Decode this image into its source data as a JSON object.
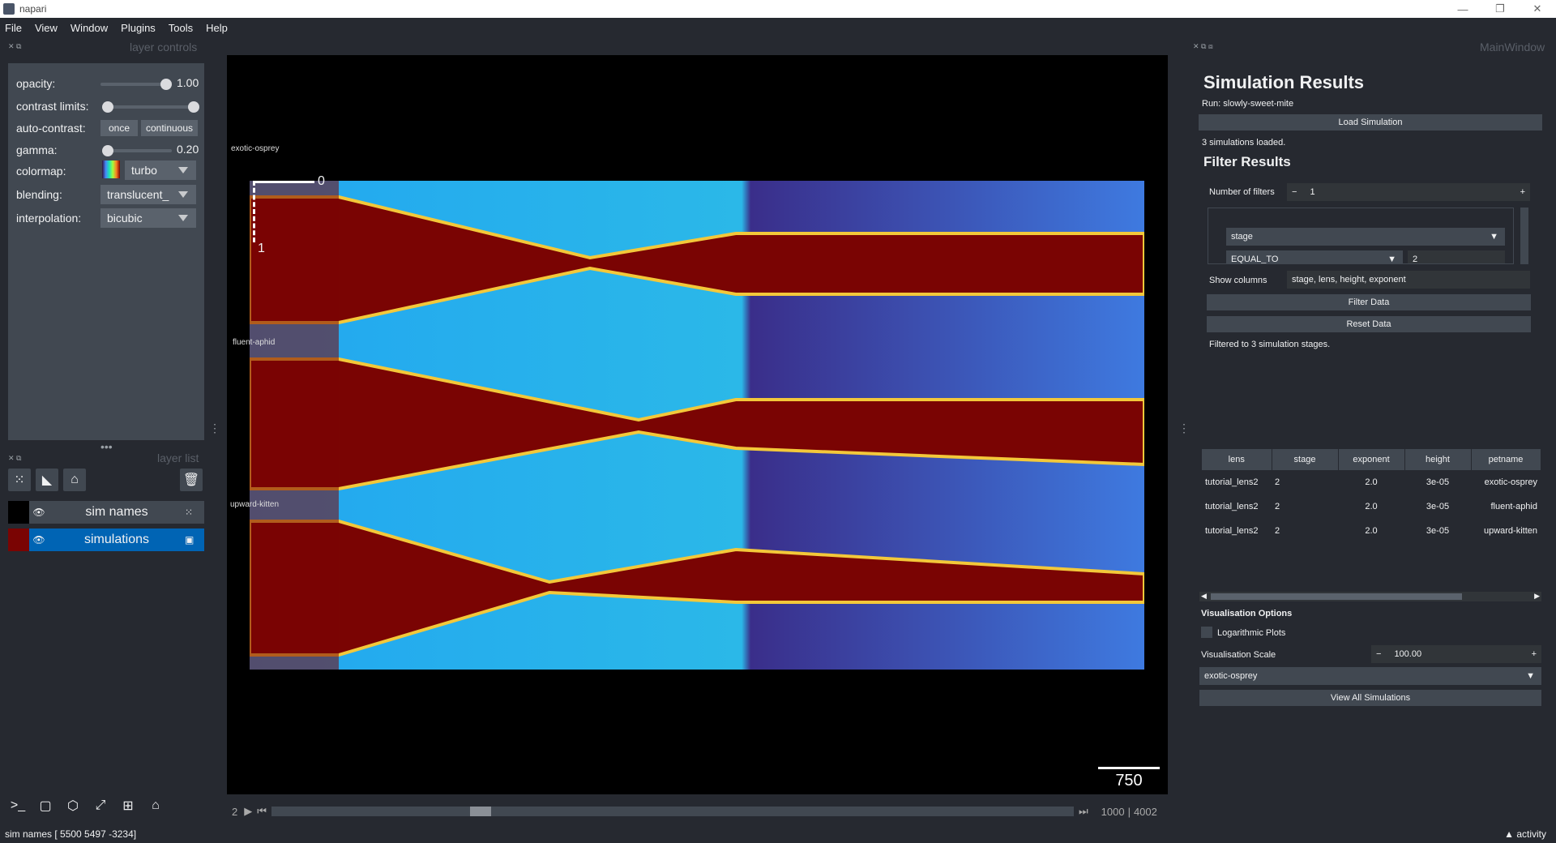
{
  "window": {
    "title": "napari",
    "minimize": "—",
    "restore": "❐",
    "close": "✕"
  },
  "menu": [
    "File",
    "View",
    "Window",
    "Plugins",
    "Tools",
    "Help"
  ],
  "layer_controls": {
    "title": "layer controls",
    "opacity_label": "opacity:",
    "opacity_value": "1.00",
    "contrast_label": "contrast limits:",
    "autocontrast_label": "auto-contrast:",
    "once": "once",
    "continuous": "continuous",
    "gamma_label": "gamma:",
    "gamma_value": "0.20",
    "colormap_label": "colormap:",
    "colormap_value": "turbo",
    "blending_label": "blending:",
    "blending_value": "translucent_",
    "interpolation_label": "interpolation:",
    "interpolation_value": "bicubic"
  },
  "layer_list": {
    "title": "layer list",
    "layers": [
      {
        "name": "sim names",
        "selected": false
      },
      {
        "name": "simulations",
        "selected": true
      }
    ]
  },
  "canvas": {
    "labels": [
      "exotic-osprey",
      "fluent-aphid",
      "upward-kitten"
    ],
    "axis_0": "0",
    "axis_1": "1",
    "scale_value": "750"
  },
  "dims": {
    "index": "2",
    "current": "1000",
    "total": "4002",
    "sep": "|"
  },
  "right": {
    "dock_title": "MainWindow",
    "title": "Simulation Results",
    "run": "Run: slowly-sweet-mite",
    "load_button": "Load Simulation",
    "loaded_msg": "3 simulations loaded.",
    "filter_title": "Filter Results",
    "num_filters_label": "Number of filters",
    "num_filters_value": "1",
    "filter_field": "stage",
    "filter_op": "EQUAL_TO",
    "filter_value": "2",
    "show_columns_label": "Show columns",
    "show_columns_value": "stage, lens, height, exponent",
    "filter_button": "Filter Data",
    "reset_button": "Reset Data",
    "filtered_msg": "Filtered to 3 simulation stages.",
    "table": {
      "headers": [
        "lens",
        "stage",
        "exponent",
        "height",
        "petname"
      ],
      "rows": [
        [
          "tutorial_lens2",
          "2",
          "2.0",
          "3e-05",
          "exotic-osprey"
        ],
        [
          "tutorial_lens2",
          "2",
          "2.0",
          "3e-05",
          "fluent-aphid"
        ],
        [
          "tutorial_lens2",
          "2",
          "2.0",
          "3e-05",
          "upward-kitten"
        ]
      ]
    },
    "vis_title": "Visualisation Options",
    "log_label": "Logarithmic Plots",
    "scale_label": "Visualisation Scale",
    "scale_value": "100.00",
    "sim_select": "exotic-osprey",
    "view_all_button": "View All Simulations"
  },
  "status": {
    "text": "sim names [ 5500  5497 -3234]",
    "activity": "activity"
  }
}
